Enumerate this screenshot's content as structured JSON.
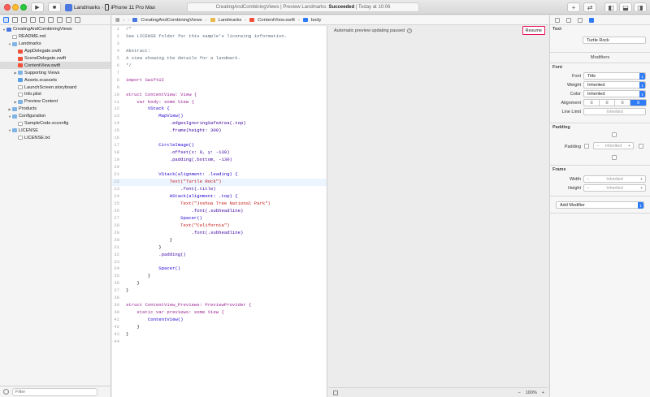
{
  "toolbar": {
    "scheme": "Landmarks",
    "device": "iPhone 11 Pro Max",
    "status_project": "CreatingAndCombiningViews",
    "status_preview": "Preview Landmarks:",
    "status_result": "Succeeded",
    "status_time": "Today at 10:06",
    "add_label": "+"
  },
  "navigator": {
    "items": [
      {
        "label": "CreatingAndCombiningViews",
        "depth": 0,
        "icon": "project",
        "arrow": "▼"
      },
      {
        "label": "README.md",
        "depth": 1,
        "icon": "file",
        "arrow": ""
      },
      {
        "label": "Landmarks",
        "depth": 1,
        "icon": "folder",
        "arrow": "▼"
      },
      {
        "label": "AppDelegate.swift",
        "depth": 2,
        "icon": "swift",
        "arrow": ""
      },
      {
        "label": "SceneDelegate.swift",
        "depth": 2,
        "icon": "swift",
        "arrow": ""
      },
      {
        "label": "ContentView.swift",
        "depth": 2,
        "icon": "swift",
        "arrow": "",
        "selected": true
      },
      {
        "label": "Supporting Views",
        "depth": 2,
        "icon": "folder",
        "arrow": "▶"
      },
      {
        "label": "Assets.xcassets",
        "depth": 2,
        "icon": "assets",
        "arrow": ""
      },
      {
        "label": "LaunchScreen.storyboard",
        "depth": 2,
        "icon": "file",
        "arrow": ""
      },
      {
        "label": "Info.plist",
        "depth": 2,
        "icon": "file",
        "arrow": ""
      },
      {
        "label": "Preview Content",
        "depth": 2,
        "icon": "folder",
        "arrow": "▶"
      },
      {
        "label": "Products",
        "depth": 1,
        "icon": "folder",
        "arrow": "▶"
      },
      {
        "label": "Configuration",
        "depth": 1,
        "icon": "folder",
        "arrow": "▼"
      },
      {
        "label": "SampleCode.xcconfig",
        "depth": 2,
        "icon": "file",
        "arrow": ""
      },
      {
        "label": "LICENSE",
        "depth": 1,
        "icon": "folder",
        "arrow": "▼"
      },
      {
        "label": "LICENSE.txt",
        "depth": 2,
        "icon": "file",
        "arrow": ""
      }
    ],
    "filter_placeholder": "Filter"
  },
  "jumpbar": {
    "crumbs": [
      "CreatingAndCombiningViews",
      "Landmarks",
      "ContentView.swift",
      "body"
    ]
  },
  "editor": {
    "lines": [
      {
        "n": "1",
        "t": "/*",
        "c": "cmt"
      },
      {
        "n": "2",
        "t": "See LICENSE folder for this sample's licensing information.",
        "c": "cmt"
      },
      {
        "n": "3",
        "t": "",
        "c": "cmt"
      },
      {
        "n": "4",
        "t": "Abstract:",
        "c": "cmt"
      },
      {
        "n": "5",
        "t": "A view showing the details for a landmark.",
        "c": "cmt"
      },
      {
        "n": "6",
        "t": "*/",
        "c": "cmt"
      },
      {
        "n": "7",
        "t": "",
        "c": "norm"
      },
      {
        "n": "8",
        "t": "import SwiftUI",
        "c": "kw"
      },
      {
        "n": "9",
        "t": "",
        "c": "norm"
      },
      {
        "n": "10",
        "t": "struct ContentView: View {",
        "c": "kw"
      },
      {
        "n": "11",
        "t": "    var body: some View {",
        "c": "kw"
      },
      {
        "n": "12",
        "t": "        VStack {",
        "c": "ty"
      },
      {
        "n": "13",
        "t": "            MapView()",
        "c": "ty"
      },
      {
        "n": "14",
        "t": "                .edgesIgnoringSafeArea(.top)",
        "c": "meth"
      },
      {
        "n": "15",
        "t": "                .frame(height: 300)",
        "c": "meth"
      },
      {
        "n": "16",
        "t": "",
        "c": "norm"
      },
      {
        "n": "17",
        "t": "            CircleImage()",
        "c": "ty"
      },
      {
        "n": "18",
        "t": "                .offset(x: 0, y: -130)",
        "c": "meth"
      },
      {
        "n": "19",
        "t": "                .padding(.bottom, -130)",
        "c": "meth"
      },
      {
        "n": "20",
        "t": "",
        "c": "norm"
      },
      {
        "n": "21",
        "t": "            VStack(alignment: .leading) {",
        "c": "ty"
      },
      {
        "n": "22",
        "t": "                Text(\"Turtle Rock\")",
        "c": "str",
        "hl": true
      },
      {
        "n": "23",
        "t": "                    .font(.title)",
        "c": "meth"
      },
      {
        "n": "24",
        "t": "                HStack(alignment: .top) {",
        "c": "ty"
      },
      {
        "n": "25",
        "t": "                    Text(\"Joshua Tree National Park\")",
        "c": "str"
      },
      {
        "n": "26",
        "t": "                        .font(.subheadline)",
        "c": "meth"
      },
      {
        "n": "27",
        "t": "                    Spacer()",
        "c": "ty"
      },
      {
        "n": "28",
        "t": "                    Text(\"California\")",
        "c": "str"
      },
      {
        "n": "29",
        "t": "                        .font(.subheadline)",
        "c": "meth"
      },
      {
        "n": "30",
        "t": "                }",
        "c": "norm"
      },
      {
        "n": "31",
        "t": "            }",
        "c": "norm"
      },
      {
        "n": "32",
        "t": "            .padding()",
        "c": "meth"
      },
      {
        "n": "33",
        "t": "",
        "c": "norm"
      },
      {
        "n": "34",
        "t": "            Spacer()",
        "c": "ty"
      },
      {
        "n": "35",
        "t": "        }",
        "c": "norm"
      },
      {
        "n": "36",
        "t": "    }",
        "c": "norm"
      },
      {
        "n": "37",
        "t": "}",
        "c": "norm"
      },
      {
        "n": "38",
        "t": "",
        "c": "norm"
      },
      {
        "n": "39",
        "t": "struct ContentView_Previews: PreviewProvider {",
        "c": "kw"
      },
      {
        "n": "40",
        "t": "    static var previews: some View {",
        "c": "kw"
      },
      {
        "n": "41",
        "t": "        ContentView()",
        "c": "ty"
      },
      {
        "n": "42",
        "t": "    }",
        "c": "norm"
      },
      {
        "n": "43",
        "t": "}",
        "c": "norm"
      },
      {
        "n": "44",
        "t": "",
        "c": "norm"
      }
    ]
  },
  "preview": {
    "status_text": "Automatic preview updating paused",
    "resume_label": "Resume",
    "zoom": "100%",
    "zoom_in": "+",
    "zoom_out": "−"
  },
  "inspector": {
    "text_section": "Text",
    "text_value": "Turtle Rock",
    "modifiers_title": "Modifiers",
    "font_section": "Font",
    "font_label": "Font",
    "font_value": "Title",
    "weight_label": "Weight",
    "weight_value": "Inherited",
    "color_label": "Color",
    "color_value": "Inherited",
    "alignment_label": "Alignment",
    "linelimit_label": "Line Limit",
    "linelimit_value": "Inherited",
    "padding_section": "Padding",
    "padding_label": "Padding",
    "padding_value": "Inherited",
    "frame_section": "Frame",
    "width_label": "Width",
    "width_value": "Inherited",
    "height_label": "Height",
    "height_value": "Inherited",
    "add_modifier": "Add Modifier"
  }
}
